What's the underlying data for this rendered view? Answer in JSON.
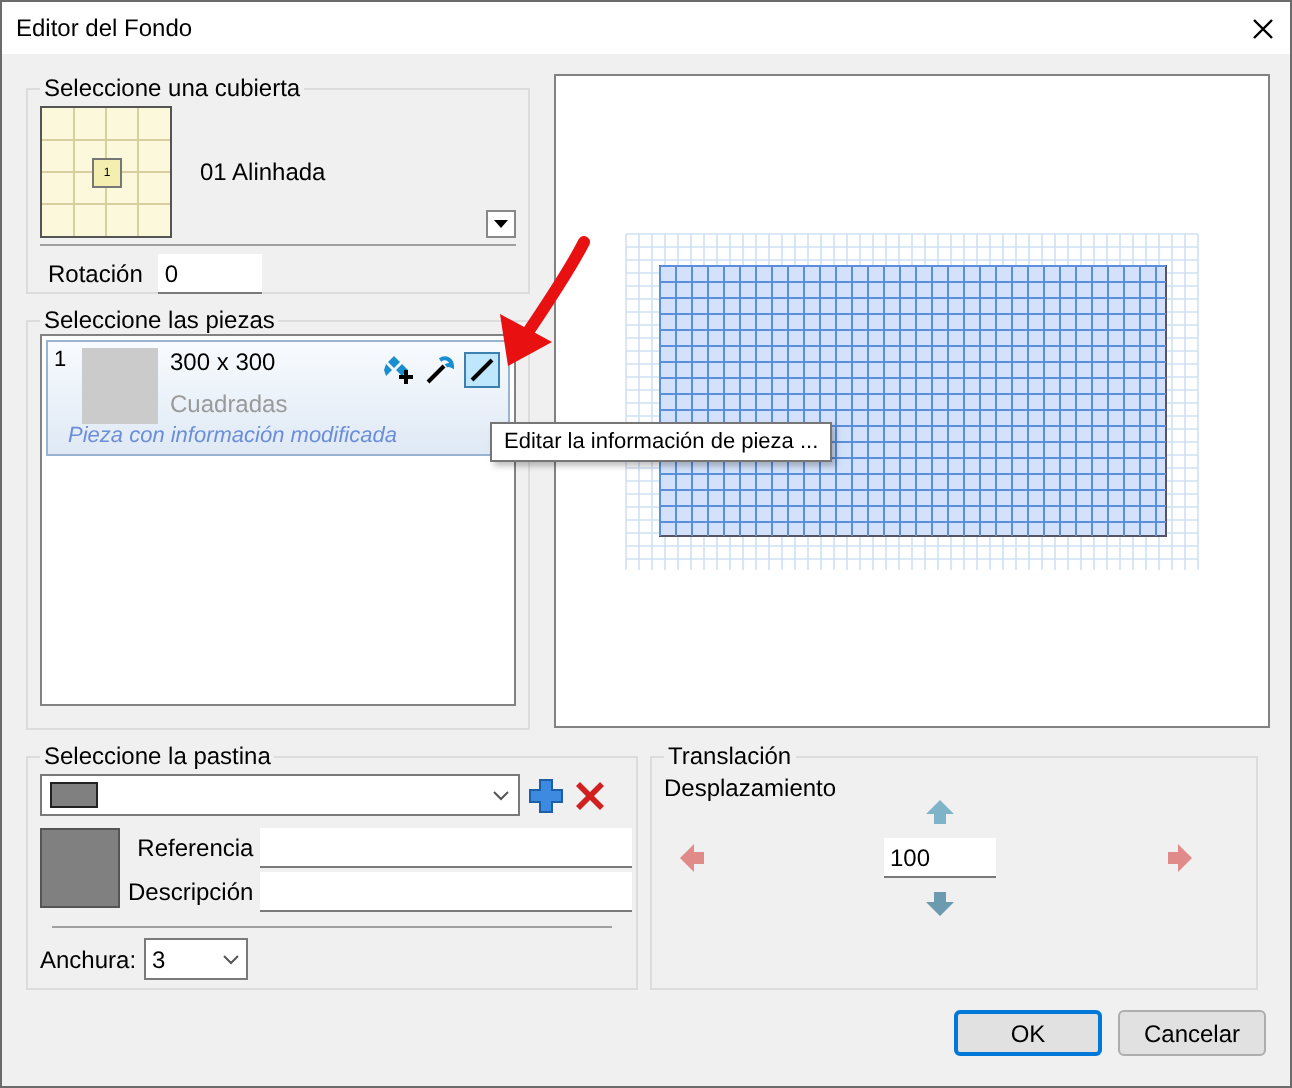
{
  "window": {
    "title": "Editor del Fondo"
  },
  "deck": {
    "legend": "Seleccione una cubierta",
    "thumb_label": "1",
    "name": "01 Alinhada"
  },
  "rotation": {
    "label": "Rotación",
    "value": "0"
  },
  "pieces": {
    "legend": "Seleccione las piezas",
    "items": [
      {
        "index": "1",
        "size": "300 x 300",
        "type": "Cuadradas",
        "note": "Pieza con información modificada",
        "selected": true
      }
    ]
  },
  "tooltip": "Editar la información de pieza ...",
  "grout": {
    "legend": "Seleccione la pastina",
    "color": "#808080",
    "fields": [
      {
        "label": "Referencia"
      },
      {
        "label": "Descripción"
      }
    ],
    "width_label": "Anchura:",
    "width_value": "3"
  },
  "translation": {
    "legend": "Translación",
    "label": "Desplazamiento",
    "value": "100"
  },
  "buttons": [
    {
      "label": "OK",
      "default": true
    },
    {
      "label": "Cancelar",
      "default": false
    }
  ]
}
